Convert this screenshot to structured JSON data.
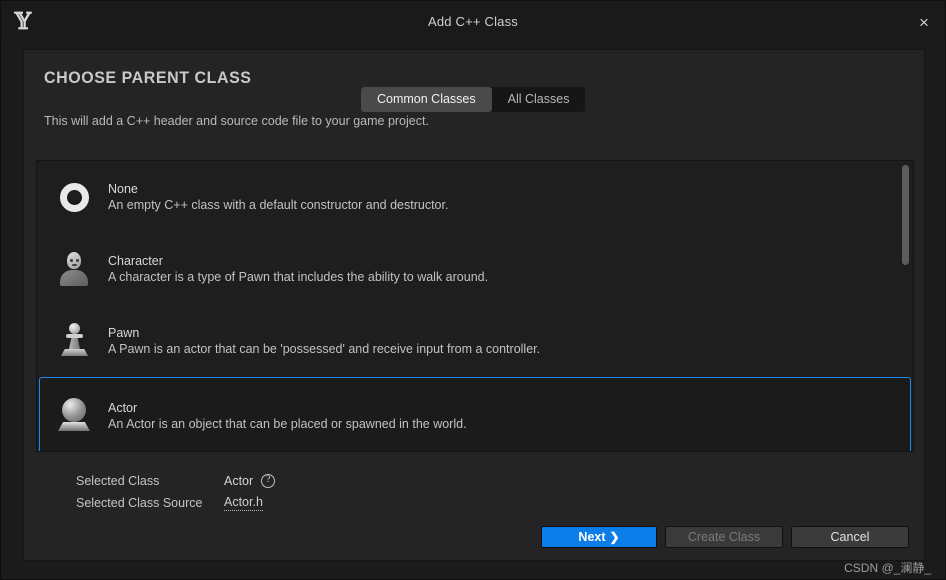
{
  "window": {
    "title": "Add C++ Class",
    "logo_icon": "unreal-engine-logo",
    "close_icon": "×"
  },
  "header": {
    "section_title": "CHOOSE PARENT CLASS",
    "subtitle": "This will add a C++ header and source code file to your game project.",
    "tabs": [
      {
        "label": "Common Classes",
        "active": true
      },
      {
        "label": "All Classes",
        "active": false
      }
    ]
  },
  "class_list": {
    "items": [
      {
        "name": "None",
        "description": "An empty C++ class with a default constructor and destructor.",
        "icon": "ring-icon",
        "selected": false
      },
      {
        "name": "Character",
        "description": "A character is a type of Pawn that includes the ability to walk around.",
        "icon": "character-icon",
        "selected": false
      },
      {
        "name": "Pawn",
        "description": "A Pawn is an actor that can be 'possessed' and receive input from a controller.",
        "icon": "pawn-icon",
        "selected": false
      },
      {
        "name": "Actor",
        "description": "An Actor is an object that can be placed or spawned in the world.",
        "icon": "actor-icon",
        "selected": true
      }
    ],
    "selection_color": "#1f8bec"
  },
  "selected_info": {
    "class_label": "Selected Class",
    "class_value": "Actor",
    "help_icon": "?",
    "source_label": "Selected Class Source",
    "source_value": "Actor.h"
  },
  "footer": {
    "next_label": "Next",
    "next_chevron": "❯",
    "create_label": "Create Class",
    "cancel_label": "Cancel",
    "primary_color": "#0c7ce9"
  },
  "watermark": {
    "text": "CSDN @_澜静_"
  }
}
